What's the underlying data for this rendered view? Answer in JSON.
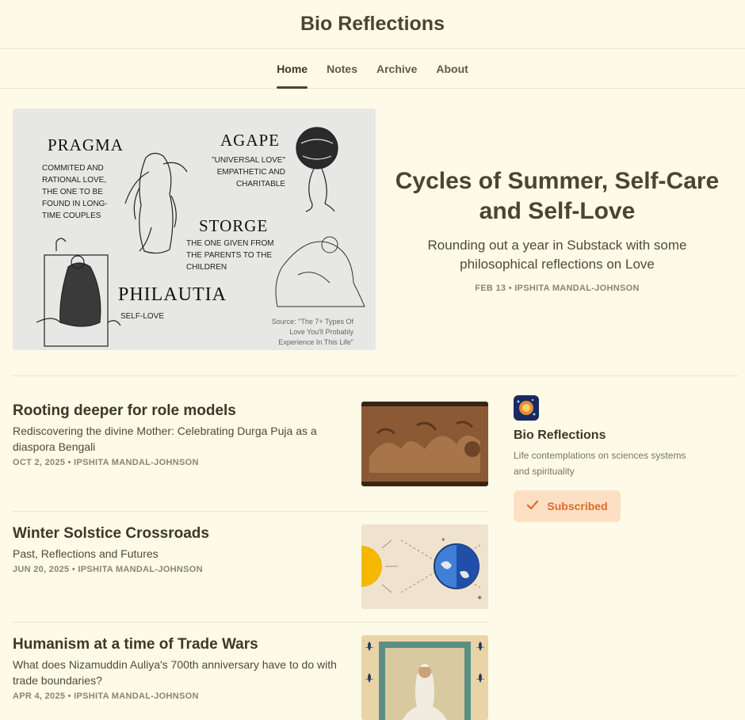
{
  "site": {
    "title": "Bio Reflections"
  },
  "nav": {
    "items": [
      {
        "label": "Home"
      },
      {
        "label": "Notes"
      },
      {
        "label": "Archive"
      },
      {
        "label": "About"
      }
    ]
  },
  "hero": {
    "title": "Cycles of Summer, Self-Care and Self-Love",
    "subtitle": "Rounding out a year in Substack with some philosophical reflections on Love",
    "meta": "FEB 13 • IPSHITA MANDAL-JOHNSON",
    "image": {
      "pragma": "PRAGMA",
      "pragma_desc": "COMMITED AND RATIONAL LOVE, THE ONE TO BE FOUND IN LONG-TIME COUPLES",
      "agape": "AGAPE",
      "agape_desc": "\"UNIVERSAL LOVE\" EMPATHETIC AND CHARITABLE",
      "storge": "STORGE",
      "storge_desc": "THE ONE GIVEN FROM THE PARENTS TO THE CHILDREN",
      "philautia": "PHILAUTIA",
      "philautia_desc": "SELF-LOVE",
      "source": "Source: \"The 7+ Types Of Love You'll Probably Experience In This Life\""
    }
  },
  "posts": [
    {
      "title": "Rooting deeper for role models",
      "subtitle": "Rediscovering the divine Mother: Celebrating Durga Puja as a diaspora Bengali",
      "meta": "OCT 2, 2025 • IPSHITA MANDAL-JOHNSON"
    },
    {
      "title": "Winter Solstice Crossroads",
      "subtitle": "Past, Reflections and Futures",
      "meta": "JUN 20, 2025 • IPSHITA MANDAL-JOHNSON"
    },
    {
      "title": "Humanism at a time of Trade Wars",
      "subtitle": "What does Nizamuddin Auliya's 700th anniversary have to do with trade boundaries?",
      "meta": "APR 4, 2025 • IPSHITA MANDAL-JOHNSON"
    }
  ],
  "sidebar": {
    "name": "Bio Reflections",
    "description": "Life contemplations on sciences systems and spirituality",
    "button_label": "Subscribed",
    "button_icon": "check-icon"
  },
  "colors": {
    "background": "#fefae8",
    "title": "#4a4530",
    "accent": "#e0692a",
    "button_bg": "#fde0c4"
  }
}
